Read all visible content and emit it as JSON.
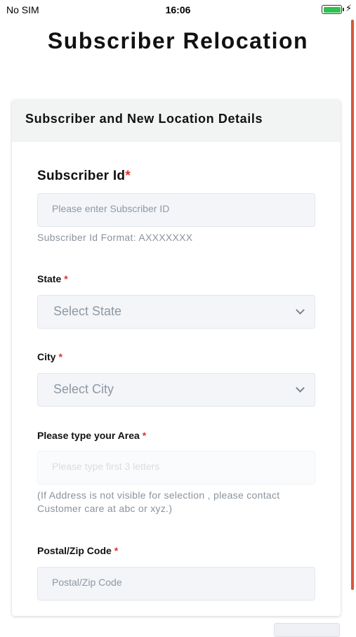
{
  "status_bar": {
    "carrier": "No SIM",
    "time": "16:06",
    "battery_level": 1.0
  },
  "page": {
    "title": "Subscriber Relocation"
  },
  "card": {
    "header": "Subscriber and New Location Details",
    "subscriber_id": {
      "label": "Subscriber Id",
      "required_mark": "*",
      "placeholder": "Please enter Subscriber ID",
      "hint": "Subscriber Id Format: AXXXXXXX"
    },
    "state": {
      "label": "State",
      "required_mark": "*",
      "selected": "Select State"
    },
    "city": {
      "label": "City",
      "required_mark": "*",
      "selected": "Select City"
    },
    "area": {
      "label": "Please type your Area",
      "required_mark": "*",
      "placeholder": "Please type first 3 letters",
      "hint": "(If Address is not visible for selection , please contact Customer care at abc or xyz.)"
    },
    "postal": {
      "label": "Postal/Zip Code",
      "required_mark": "*",
      "placeholder": "Postal/Zip Code"
    }
  },
  "colors": {
    "required": "#e0322d",
    "scroll_indicator": "#d9563a",
    "battery": "#2ec24f"
  }
}
